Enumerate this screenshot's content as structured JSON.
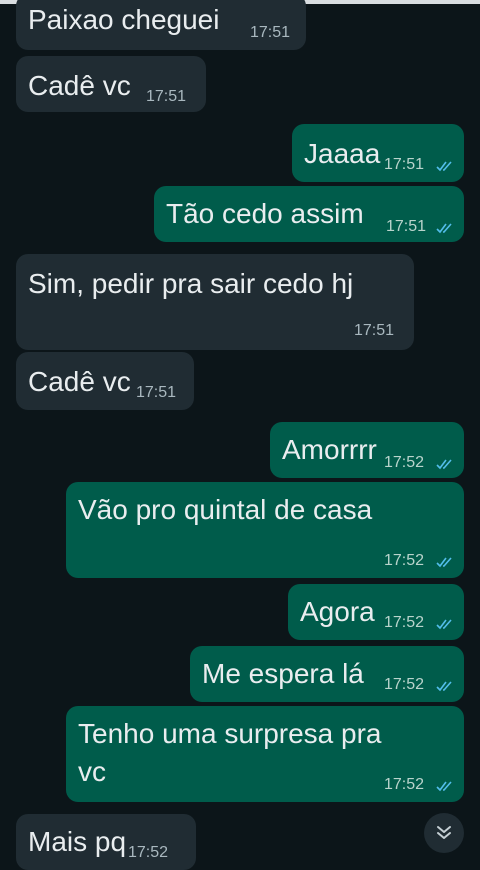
{
  "chat": {
    "messages": [
      {
        "text": "Paixao cheguei",
        "time": "17:51",
        "direction": "in"
      },
      {
        "text": "Cadê vc",
        "time": "17:51",
        "direction": "in"
      },
      {
        "text": "Jaaaa",
        "time": "17:51",
        "direction": "out",
        "status": "read"
      },
      {
        "text": "Tão cedo assim",
        "time": "17:51",
        "direction": "out",
        "status": "read"
      },
      {
        "text": "Sim, pedir pra sair cedo hj",
        "time": "17:51",
        "direction": "in"
      },
      {
        "text": "Cadê vc",
        "time": "17:51",
        "direction": "in"
      },
      {
        "text": "Amorrrr",
        "time": "17:52",
        "direction": "out",
        "status": "read"
      },
      {
        "text": "Vão pro quintal de casa",
        "time": "17:52",
        "direction": "out",
        "status": "read"
      },
      {
        "text": "Agora",
        "time": "17:52",
        "direction": "out",
        "status": "read"
      },
      {
        "text": "Me espera lá",
        "time": "17:52",
        "direction": "out",
        "status": "read"
      },
      {
        "line1": "Tenho uma surpresa pra",
        "line2": "vc",
        "time": "17:52",
        "direction": "out",
        "status": "read"
      },
      {
        "text": "Mais pq",
        "time": "17:52",
        "direction": "in"
      }
    ]
  },
  "icons": {
    "read_receipt": "double-check-icon",
    "scroll_down": "chevron-double-down-icon"
  },
  "colors": {
    "background": "#0c1519",
    "incoming_bubble": "#202c33",
    "outgoing_bubble": "#005c4b",
    "read_tick": "#53bdeb"
  }
}
